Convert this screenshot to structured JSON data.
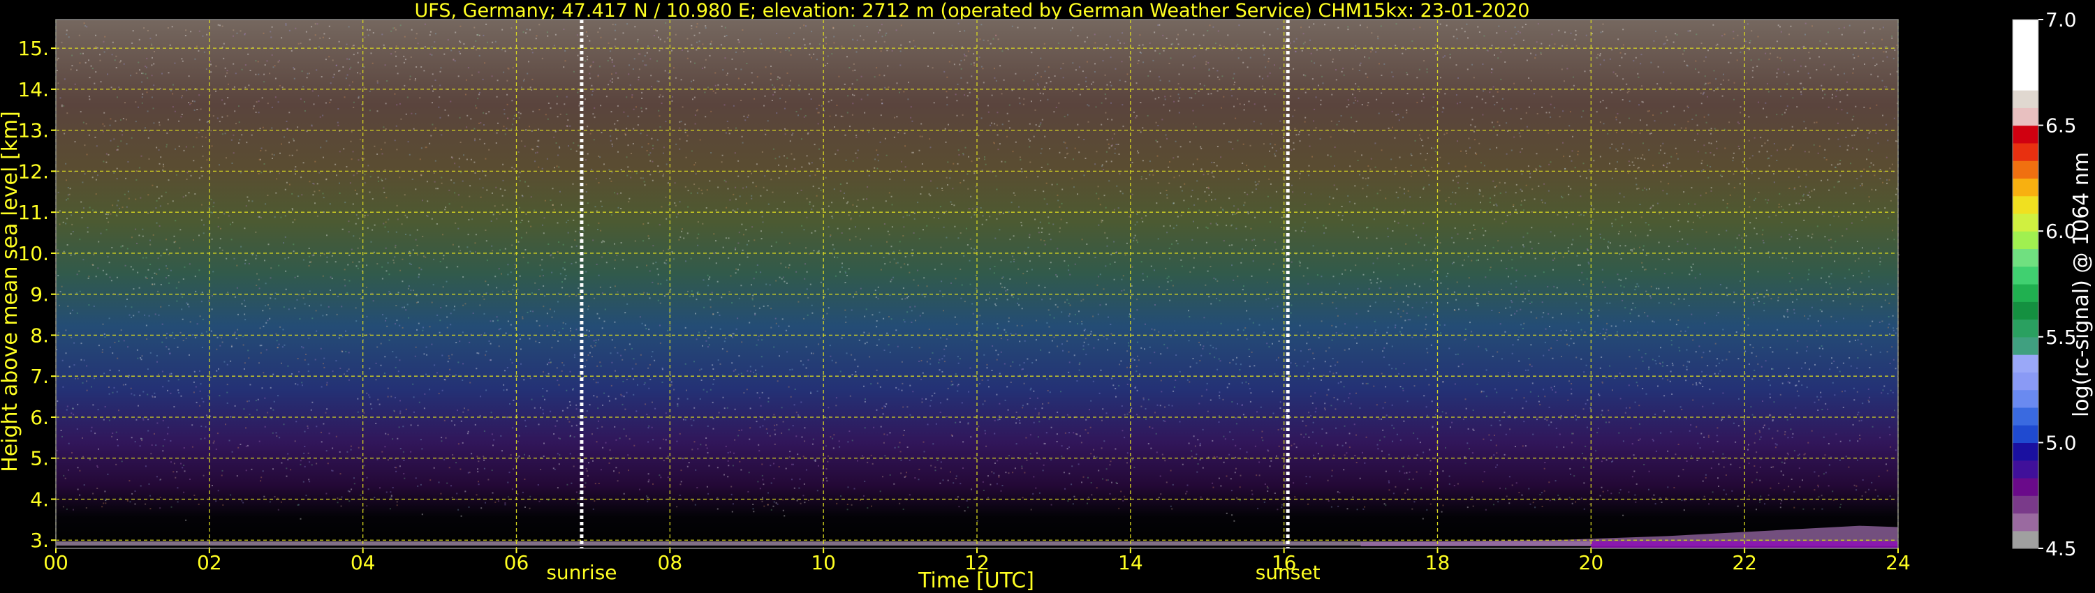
{
  "chart_data": {
    "type": "heatmap",
    "title": "UFS, Germany; 47.417 N / 10.980 E; elevation: 2712 m  (operated by German Weather Service)    CHM15kx: 23-01-2020",
    "xlabel": "Time [UTC]",
    "ylabel": "Height above mean sea level [km]",
    "xlim": [
      0,
      24
    ],
    "ylim": [
      2.8,
      15.7
    ],
    "x_ticks": [
      0,
      2,
      4,
      6,
      8,
      10,
      12,
      14,
      16,
      18,
      20,
      22,
      24
    ],
    "x_tick_labels": [
      "00",
      "02",
      "04",
      "06",
      "08",
      "10",
      "12",
      "14",
      "16",
      "18",
      "20",
      "22",
      "24"
    ],
    "y_ticks": [
      3,
      4,
      5,
      6,
      7,
      8,
      9,
      10,
      11,
      12,
      13,
      14,
      15
    ],
    "y_tick_labels": [
      "3.",
      "4.",
      "5.",
      "6.",
      "7.",
      "8.",
      "9.",
      "10.",
      "11.",
      "12.",
      "13.",
      "14.",
      "15."
    ],
    "grid": true,
    "markers": [
      {
        "label": "sunrise",
        "x": 6.85
      },
      {
        "label": "sunset",
        "x": 16.05
      }
    ],
    "colorbar": {
      "label": "log(rc-signal) @ 1064 nm",
      "range": [
        4.5,
        7.0
      ],
      "ticks": [
        4.5,
        5.0,
        5.5,
        6.0,
        6.5,
        7.0
      ],
      "tick_labels": [
        "4.5",
        "5.0",
        "5.5",
        "6.0",
        "6.5",
        "7.0"
      ],
      "colors": [
        "#a0a0a0",
        "#9a6aa0",
        "#7a3a8a",
        "#6a0a8a",
        "#40109a",
        "#1a10a0",
        "#1f4ad0",
        "#3a6ae0",
        "#6a8af0",
        "#8a9af5",
        "#9aa8f8",
        "#40a080",
        "#2aa060",
        "#149040",
        "#20b050",
        "#40d070",
        "#70e080",
        "#a0f050",
        "#d0f040",
        "#f0e020",
        "#f8b010",
        "#f07010",
        "#e83010",
        "#d00010",
        "#e8c0c0",
        "#e0d8d0",
        "#ffffff",
        "#ffffff",
        "#ffffff",
        "#ffffff"
      ]
    }
  }
}
